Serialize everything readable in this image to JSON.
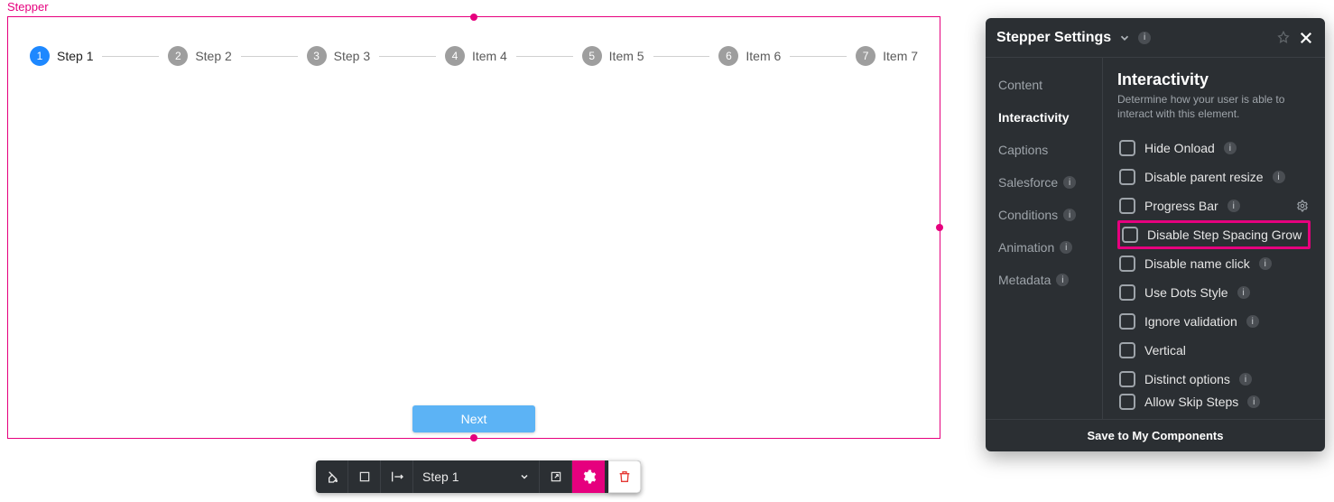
{
  "canvas": {
    "element_label": "Stepper",
    "steps": [
      {
        "num": "1",
        "label": "Step 1",
        "active": true
      },
      {
        "num": "2",
        "label": "Step 2",
        "active": false
      },
      {
        "num": "3",
        "label": "Step 3",
        "active": false
      },
      {
        "num": "4",
        "label": "Item 4",
        "active": false
      },
      {
        "num": "5",
        "label": "Item 5",
        "active": false
      },
      {
        "num": "6",
        "label": "Item 6",
        "active": false
      },
      {
        "num": "7",
        "label": "Item 7",
        "active": false
      }
    ],
    "next_button": "Next"
  },
  "toolbar": {
    "step_select": "Step 1"
  },
  "panel": {
    "title": "Stepper Settings",
    "tabs": [
      {
        "label": "Content",
        "info": false,
        "active": false
      },
      {
        "label": "Interactivity",
        "info": false,
        "active": true
      },
      {
        "label": "Captions",
        "info": false,
        "active": false
      },
      {
        "label": "Salesforce",
        "info": true,
        "active": false
      },
      {
        "label": "Conditions",
        "info": true,
        "active": false
      },
      {
        "label": "Animation",
        "info": true,
        "active": false
      },
      {
        "label": "Metadata",
        "info": true,
        "active": false
      }
    ],
    "section_title": "Interactivity",
    "section_sub": "Determine how your user is able to interact with this element.",
    "options": [
      {
        "label": "Hide Onload",
        "info": true,
        "gear": false,
        "highlight": false
      },
      {
        "label": "Disable parent resize",
        "info": true,
        "gear": false,
        "highlight": false
      },
      {
        "label": "Progress Bar",
        "info": true,
        "gear": true,
        "highlight": false
      },
      {
        "label": "Disable Step Spacing Grow",
        "info": false,
        "gear": false,
        "highlight": true
      },
      {
        "label": "Disable name click",
        "info": true,
        "gear": false,
        "highlight": false
      },
      {
        "label": "Use Dots Style",
        "info": true,
        "gear": false,
        "highlight": false
      },
      {
        "label": "Ignore validation",
        "info": true,
        "gear": false,
        "highlight": false
      },
      {
        "label": "Vertical",
        "info": false,
        "gear": false,
        "highlight": false
      },
      {
        "label": "Distinct options",
        "info": true,
        "gear": false,
        "highlight": false
      },
      {
        "label": "Allow Skip Steps",
        "info": true,
        "gear": false,
        "highlight": false,
        "truncated": true
      }
    ],
    "footer": "Save to My Components"
  }
}
